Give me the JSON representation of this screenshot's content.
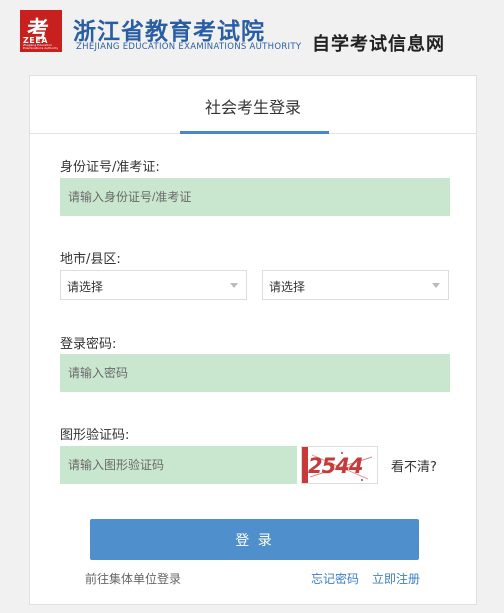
{
  "header": {
    "logo_glyph": "考",
    "logo_abbr": "ZEEA",
    "logo_tiny": "Zhejiang Education Examinations Authority",
    "org_name": "浙江省教育考试院",
    "org_name_en": "ZHEJIANG EDUCATION EXAMINATIONS AUTHORITY",
    "site_name": "自学考试信息网"
  },
  "card": {
    "title": "社会考生登录",
    "id_label": "身份证号/准考证:",
    "id_placeholder": "请输入身份证号/准考证",
    "region_label": "地市/县区:",
    "city_select": "请选择",
    "county_select": "请选择",
    "password_label": "登录密码:",
    "password_placeholder": "请输入密码",
    "captcha_label": "图形验证码:",
    "captcha_placeholder": "请输入图形验证码",
    "captcha_text": "2544",
    "refresh_text": "看不清?",
    "login_button": "登 录",
    "group_login_link": "前往集体单位登录",
    "forgot_link": "忘记密码",
    "register_link": "立即注册"
  },
  "colors": {
    "brand_blue": "#2a5ea4",
    "input_bg": "#c9e6cf",
    "button_blue": "#4f8fcb",
    "logo_red": "#c8201f"
  }
}
